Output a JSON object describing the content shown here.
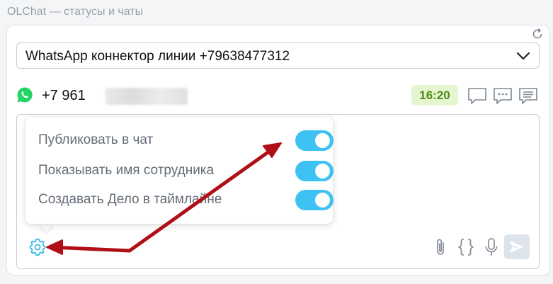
{
  "app": {
    "title": "OLChat — статусы и чаты"
  },
  "line_select": {
    "value": "WhatsApp коннектор линии +79638477312"
  },
  "contact": {
    "phone_visible": "+7 961",
    "channel_icon": "whatsapp-icon"
  },
  "time_badge": "16:20",
  "header_icons": [
    "chat-bubble-icon",
    "chat-dots-icon",
    "chat-lines-icon"
  ],
  "settings_popover": {
    "options": [
      {
        "label": "Публиковать в чат",
        "enabled": true
      },
      {
        "label": "Показывать имя сотрудника",
        "enabled": true
      },
      {
        "label": "Создавать Дело в таймлайне",
        "enabled": true
      }
    ]
  },
  "composer_toolbar": [
    "settings-icon",
    "paperclip-icon",
    "braces-icon",
    "microphone-icon",
    "send-icon"
  ],
  "colors": {
    "toggle_on": "#3ec1f3",
    "time_badge_bg": "#e4f5cf",
    "time_badge_text": "#4f8a1b",
    "accent_icon": "#35b4e6",
    "annotation_arrow": "#b00f16",
    "whatsapp": "#25d366"
  }
}
